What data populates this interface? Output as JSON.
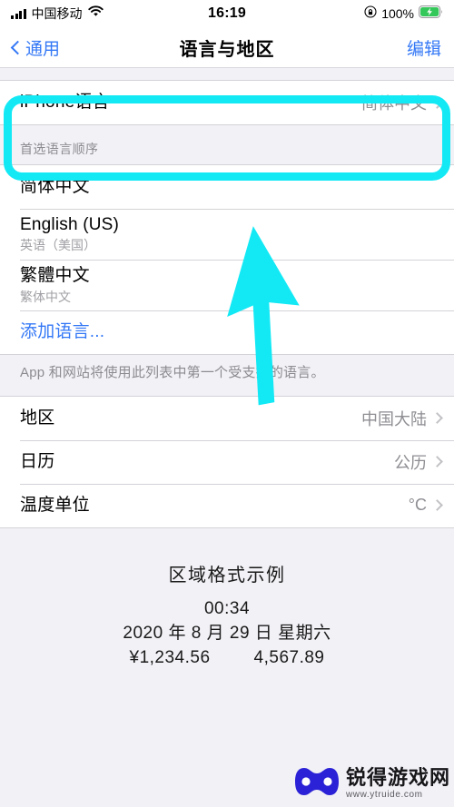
{
  "status_bar": {
    "carrier": "中国移动",
    "signal_icon": "signal-bars-icon",
    "wifi_icon": "wifi-icon",
    "time": "16:19",
    "rotation_lock_icon": "rotation-lock-icon",
    "battery_percent": "100%",
    "battery_icon": "battery-charging-icon",
    "battery_color": "#34C759"
  },
  "nav_bar": {
    "back_label": "通用",
    "back_icon": "chevron-left-icon",
    "title": "语言与地区",
    "action_label": "编辑",
    "tint_color": "#3478F6"
  },
  "iphone_language": {
    "label": "iPhone语言",
    "value": "简体中文",
    "chevron_icon": "chevron-right-icon"
  },
  "preferred_languages": {
    "header": "首选语言顺序",
    "items": [
      {
        "title": "简体中文",
        "subtitle": ""
      },
      {
        "title": "English (US)",
        "subtitle": "英语（美国）"
      },
      {
        "title": "繁體中文",
        "subtitle": "繁体中文"
      }
    ],
    "add_language_label": "添加语言...",
    "footer": "App 和网站将使用此列表中第一个受支持的语言。"
  },
  "region_settings": {
    "rows": [
      {
        "label": "地区",
        "value": "中国大陆",
        "chevron_icon": "chevron-right-icon"
      },
      {
        "label": "日历",
        "value": "公历",
        "chevron_icon": "chevron-right-icon"
      },
      {
        "label": "温度单位",
        "value": "°C",
        "chevron_icon": "chevron-right-icon"
      }
    ]
  },
  "region_format_example": {
    "title": "区域格式示例",
    "time": "00:34",
    "date": "2020 年 8 月 29 日 星期六",
    "currency": "¥1,234.56",
    "number": "4,567.89"
  },
  "annotation": {
    "highlight_color": "#13E9F5",
    "arrow_icon": "arrow-cursor-pointer",
    "highlight_target": "iPhone语言"
  },
  "watermark": {
    "name": "锐得游戏网",
    "url": "www.ytruide.com",
    "logo_icon": "gamepad-logo-icon",
    "logo_color": "#2B21D6"
  }
}
